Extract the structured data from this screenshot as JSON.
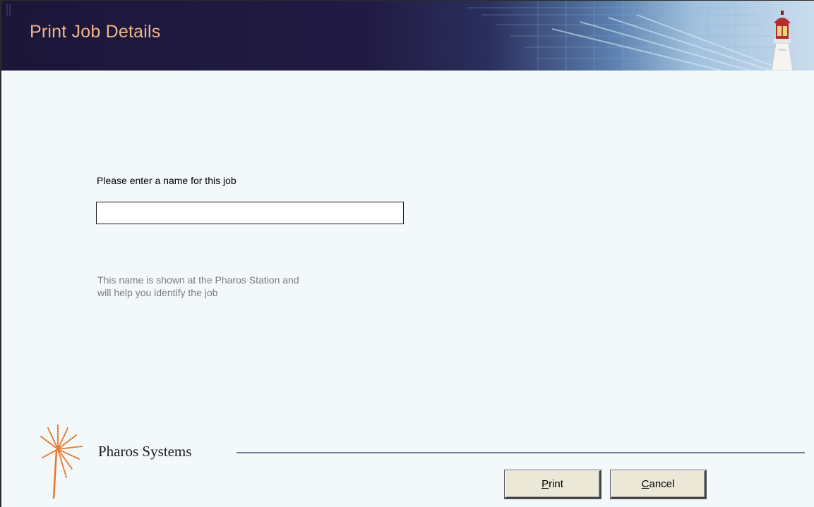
{
  "header": {
    "title": "Print Job Details",
    "icon": "lighthouse-icon"
  },
  "form": {
    "prompt_label": "Please enter a name for this job",
    "job_name_value": "",
    "job_name_placeholder": "",
    "help_line1": "This name is shown at the Pharos Station and",
    "help_line2": "will help you identify the job"
  },
  "footer": {
    "brand_name": "Pharos Systems",
    "brand_logo": "pharos-burst-logo",
    "print_accel": "P",
    "print_rest": "rint",
    "cancel_accel": "C",
    "cancel_rest": "ancel"
  },
  "colors": {
    "title": "#f2b58a",
    "background": "#f3f8fb",
    "header_dark": "#1b1638",
    "help_text": "#7c7c7c",
    "button_face": "#ece8d8",
    "brand_accent": "#e8762a"
  }
}
